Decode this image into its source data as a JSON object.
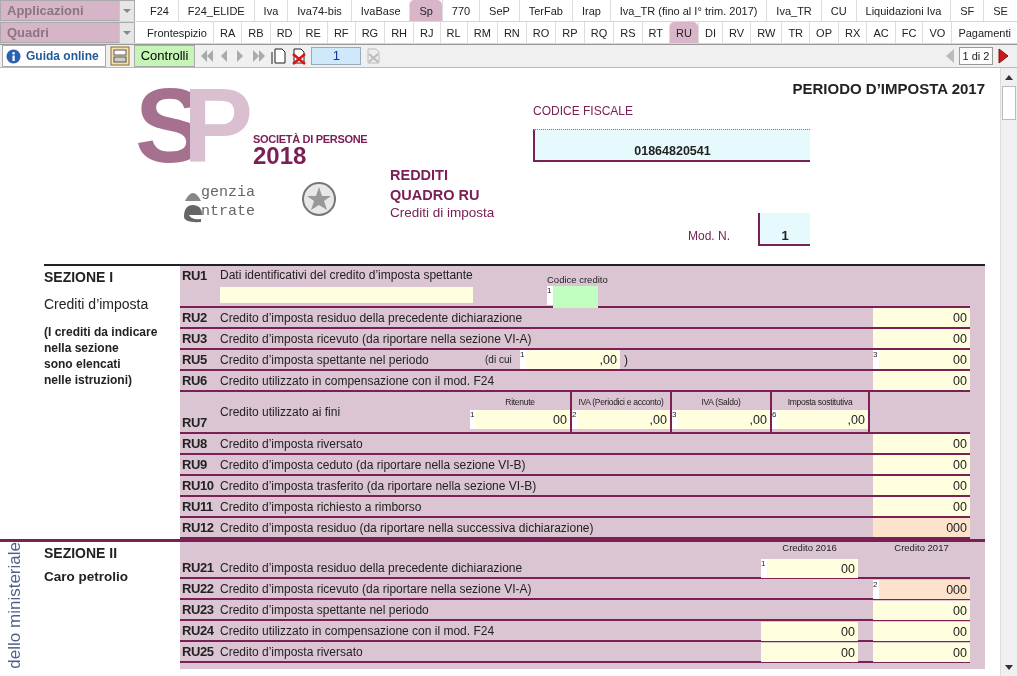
{
  "applications_combo": {
    "label": "Applicazioni"
  },
  "app_tabs": [
    {
      "label": "F24",
      "selected": false
    },
    {
      "label": "F24_ELIDE",
      "selected": false
    },
    {
      "label": "Iva",
      "selected": false
    },
    {
      "label": "Iva74-bis",
      "selected": false
    },
    {
      "label": "IvaBase",
      "selected": false
    },
    {
      "label": "Sp",
      "selected": true
    },
    {
      "label": "770",
      "selected": false
    },
    {
      "label": "SeP",
      "selected": false
    },
    {
      "label": "TerFab",
      "selected": false
    },
    {
      "label": "Irap",
      "selected": false
    },
    {
      "label": "Iva_TR (fino al I° trim. 2017)",
      "selected": false
    },
    {
      "label": "Iva_TR",
      "selected": false
    },
    {
      "label": "CU",
      "selected": false
    },
    {
      "label": "Liquidazioni Iva",
      "selected": false
    },
    {
      "label": "SF",
      "selected": false
    },
    {
      "label": "SE",
      "selected": false
    }
  ],
  "sections_combo": {
    "label": "Quadri"
  },
  "quadro_tabs": [
    {
      "label": "Frontespizio",
      "selected": false
    },
    {
      "label": "RA",
      "selected": false
    },
    {
      "label": "RB",
      "selected": false
    },
    {
      "label": "RD",
      "selected": false
    },
    {
      "label": "RE",
      "selected": false
    },
    {
      "label": "RF",
      "selected": false
    },
    {
      "label": "RG",
      "selected": false
    },
    {
      "label": "RH",
      "selected": false
    },
    {
      "label": "RJ",
      "selected": false
    },
    {
      "label": "RL",
      "selected": false
    },
    {
      "label": "RM",
      "selected": false
    },
    {
      "label": "RN",
      "selected": false
    },
    {
      "label": "RO",
      "selected": false
    },
    {
      "label": "RP",
      "selected": false
    },
    {
      "label": "RQ",
      "selected": false
    },
    {
      "label": "RS",
      "selected": false
    },
    {
      "label": "RT",
      "selected": false
    },
    {
      "label": "RU",
      "selected": true
    },
    {
      "label": "DI",
      "selected": false
    },
    {
      "label": "RV",
      "selected": false
    },
    {
      "label": "RW",
      "selected": false
    },
    {
      "label": "TR",
      "selected": false
    },
    {
      "label": "OP",
      "selected": false
    },
    {
      "label": "RX",
      "selected": false
    },
    {
      "label": "AC",
      "selected": false
    },
    {
      "label": "FC",
      "selected": false
    },
    {
      "label": "VO",
      "selected": false
    },
    {
      "label": "Pagamenti",
      "selected": false
    }
  ],
  "toolbar": {
    "help_button": "Guida online",
    "check_button": "Controlli",
    "page_field": "1",
    "page_indicator": "1 di 2"
  },
  "header": {
    "logo": {
      "monogram": [
        "S",
        "P"
      ],
      "title": "SOCIETÀ DI PERSONE",
      "year": "2018",
      "agency_lines": [
        "genzia",
        "ntrate"
      ]
    },
    "form_lines": [
      "REDDITI",
      "QUADRO RU"
    ],
    "form_subtitle": "Crediti di imposta",
    "tax_code_label": "CODICE FISCALE",
    "tax_code": "01864820541",
    "model_label": "Mod. N.",
    "model_number": "1",
    "period": "PERIODO D’IMPOSTA 2017"
  },
  "side_caption": "dello ministeriale",
  "sections": [
    {
      "title": "SEZIONE I",
      "subtitle": "Crediti d’imposta",
      "note_lines": [
        "(I crediti da indicare",
        "nella sezione",
        "sono elencati",
        "nelle istruzioni)"
      ],
      "rows": [
        {
          "kind": "ident",
          "code": "RU1",
          "label": "Dati identificativi del credito d’imposta spettante",
          "code_header": "Codice credito",
          "code_index": "1"
        },
        {
          "kind": "amount",
          "code": "RU2",
          "label": "Credito d’imposta residuo della precedente dichiarazione",
          "field": {
            "value": "00",
            "computed": false
          }
        },
        {
          "kind": "amount",
          "code": "RU3",
          "label": "Credito d’imposta ricevuto (da riportare nella sezione VI-A)",
          "field": {
            "value": "00",
            "computed": false
          }
        },
        {
          "kind": "partial",
          "code": "RU5",
          "label": "Credito d’imposta spettante nel periodo",
          "part_open": "(di cui",
          "part": {
            "index": "1",
            "value": ",00",
            "computed": false
          },
          "part_close": ")",
          "field": {
            "index": "3",
            "value": "00",
            "computed": false
          }
        },
        {
          "kind": "amount",
          "code": "RU6",
          "label": "Credito utilizzato in compensazione con il mod. F24",
          "field": {
            "value": "00",
            "computed": false
          }
        },
        {
          "kind": "multi",
          "code": "RU7",
          "label": "Credito utilizzato ai fini",
          "subfields": [
            {
              "header": "Ritenute",
              "index": "1",
              "value": "00",
              "computed": false
            },
            {
              "header": "IVA (Periodici e acconto)",
              "index": "2",
              "value": ",00",
              "computed": false
            },
            {
              "header": "IVA (Saldo)",
              "index": "3",
              "value": ",00",
              "computed": false
            },
            {
              "header": "Imposta sostitutiva",
              "index": "6",
              "value": ",00",
              "computed": false
            }
          ]
        },
        {
          "kind": "amount",
          "code": "RU8",
          "label": "Credito d’imposta riversato",
          "field": {
            "value": "00",
            "computed": false
          }
        },
        {
          "kind": "amount",
          "code": "RU9",
          "label": "Credito d’imposta ceduto (da riportare nella sezione VI-B)",
          "field": {
            "value": "00",
            "computed": false
          }
        },
        {
          "kind": "amount",
          "code": "RU10",
          "label": "Credito d’imposta trasferito (da riportare nella sezione VI-B)",
          "field": {
            "value": "00",
            "computed": false
          }
        },
        {
          "kind": "amount",
          "code": "RU11",
          "label": "Credito d’imposta richiesto a rimborso",
          "field": {
            "value": "00",
            "computed": false
          }
        },
        {
          "kind": "amount",
          "code": "RU12",
          "label": "Credito d’imposta residuo (da riportare nella successiva dichiarazione)",
          "field": {
            "value": "000",
            "computed": true
          }
        }
      ]
    },
    {
      "title": "SEZIONE II",
      "subtitle": "Caro petrolio",
      "column_headers": [
        "Credito 2016",
        "Credito 2017"
      ],
      "rows": [
        {
          "kind": "pair",
          "code": "RU21",
          "label": "Credito d’imposta residuo della precedente dichiarazione",
          "credit_2016": {
            "index": "1",
            "value": "00",
            "computed": false
          }
        },
        {
          "kind": "pair",
          "code": "RU22",
          "label": "Credito d’imposta ricevuto (da riportare nella sezione VI-A)",
          "credit_2017": {
            "index": "2",
            "value": "000",
            "computed": true
          }
        },
        {
          "kind": "pair",
          "code": "RU23",
          "label": "Credito d’imposta spettante nel periodo",
          "credit_2017": {
            "value": "00",
            "computed": false
          }
        },
        {
          "kind": "pair",
          "code": "RU24",
          "label": "Credito utilizzato in compensazione con il mod. F24",
          "credit_2016": {
            "value": "00",
            "computed": false
          },
          "credit_2017": {
            "value": "00",
            "computed": false
          }
        },
        {
          "kind": "pair",
          "code": "RU25",
          "label": "Credito d’imposta riversato",
          "credit_2016": {
            "value": "00",
            "computed": false
          },
          "credit_2017": {
            "value": "00",
            "computed": false
          }
        }
      ]
    }
  ]
}
